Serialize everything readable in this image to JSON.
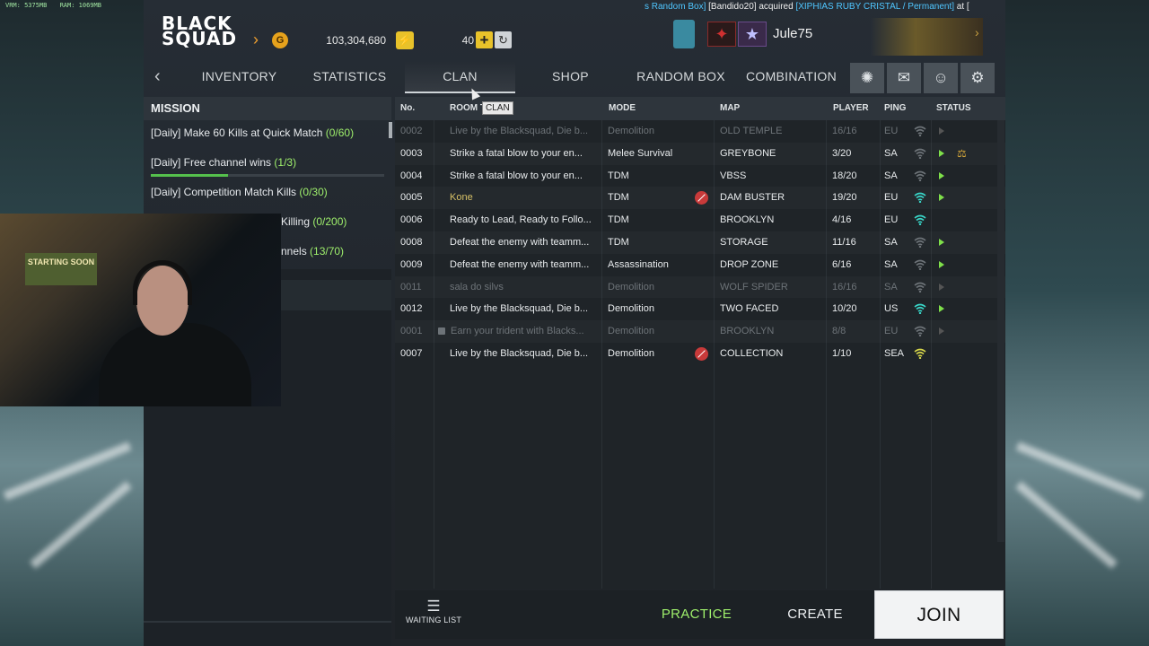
{
  "overlay": {
    "vram": "VRM: 5375MB",
    "ram": "RAM: 1069MB"
  },
  "header": {
    "logo_line1": "BLACK",
    "logo_line2": "SQUAD",
    "gold_icon": "G",
    "gold": "103,304,680",
    "cash": "40",
    "username": "Jule75",
    "ticker_pre": "s Random Box]",
    "ticker_player": "[Bandido20] acquired ",
    "ticker_item": "[XIPHIAS RUBY CRISTAL / Permanent]",
    "ticker_post": " at ["
  },
  "nav": {
    "tabs": [
      "INVENTORY",
      "STATISTICS",
      "CLAN",
      "SHOP",
      "RANDOM BOX",
      "COMBINATION"
    ],
    "active": "CLAN",
    "tooltip": "CLAN",
    "icons": [
      "gear-badge-icon",
      "mail-icon",
      "friends-icon",
      "settings-icon"
    ]
  },
  "mission": {
    "title": "MISSION",
    "items": [
      {
        "label": "[Daily] Make 60 Kills at Quick Match",
        "count": "(0/60)",
        "progress": 0
      },
      {
        "label": "[Daily] Free channel wins",
        "count": "(1/3)",
        "progress": 0.33
      },
      {
        "label": "[Daily] Competition Match Kills",
        "count": "(0/30)",
        "progress": 0
      },
      {
        "label": "Killing",
        "count": "(0/200)",
        "progress": 0
      },
      {
        "label": "nnels",
        "count": "(13/70)",
        "progress": 0
      }
    ]
  },
  "webcam": {
    "poster": "STARTING SOON"
  },
  "table": {
    "headers": {
      "no": "No.",
      "room": "ROOM T",
      "mode": "MODE",
      "map": "MAP",
      "player": "PLAYER",
      "ping": "PING",
      "status": "STATUS"
    },
    "rows": [
      {
        "no": "0002",
        "room": "Live by the Blacksquad, Die b...",
        "mode": "Demolition",
        "map": "OLD TEMPLE",
        "player": "16/16",
        "region": "EU",
        "dim": true,
        "clan": false,
        "restricted": false,
        "locked": false,
        "ping": "weak",
        "play": true,
        "trophy": false
      },
      {
        "no": "0003",
        "room": "Strike a fatal blow to your en...",
        "mode": "Melee Survival",
        "map": "GREYBONE",
        "player": "3/20",
        "region": "SA",
        "dim": false,
        "clan": false,
        "restricted": false,
        "locked": false,
        "ping": "weak",
        "play": true,
        "trophy": true
      },
      {
        "no": "0004",
        "room": "Strike a fatal blow to your en...",
        "mode": "TDM",
        "map": "VBSS",
        "player": "18/20",
        "region": "SA",
        "dim": false,
        "clan": false,
        "restricted": false,
        "locked": false,
        "ping": "weak",
        "play": true,
        "trophy": false
      },
      {
        "no": "0005",
        "room": "Kone",
        "mode": "TDM",
        "map": "DAM BUSTER",
        "player": "19/20",
        "region": "EU",
        "dim": false,
        "clan": true,
        "restricted": true,
        "locked": false,
        "ping": "good",
        "play": true,
        "trophy": false
      },
      {
        "no": "0006",
        "room": "Ready to Lead, Ready to Follo...",
        "mode": "TDM",
        "map": "BROOKLYN",
        "player": "4/16",
        "region": "EU",
        "dim": false,
        "clan": false,
        "restricted": false,
        "locked": false,
        "ping": "good",
        "play": false,
        "trophy": false
      },
      {
        "no": "0008",
        "room": "Defeat the enemy with teamm...",
        "mode": "TDM",
        "map": "STORAGE",
        "player": "11/16",
        "region": "SA",
        "dim": false,
        "clan": false,
        "restricted": false,
        "locked": false,
        "ping": "weak",
        "play": true,
        "trophy": false
      },
      {
        "no": "0009",
        "room": "Defeat the enemy with teamm...",
        "mode": "Assassination",
        "map": "DROP ZONE",
        "player": "6/16",
        "region": "SA",
        "dim": false,
        "clan": false,
        "restricted": false,
        "locked": false,
        "ping": "weak",
        "play": true,
        "trophy": false
      },
      {
        "no": "0011",
        "room": "sala do silvs",
        "mode": "Demolition",
        "map": "WOLF SPIDER",
        "player": "16/16",
        "region": "SA",
        "dim": true,
        "clan": false,
        "restricted": false,
        "locked": false,
        "ping": "weak",
        "play": true,
        "trophy": false
      },
      {
        "no": "0012",
        "room": "Live by the Blacksquad, Die b...",
        "mode": "Demolition",
        "map": "TWO FACED",
        "player": "10/20",
        "region": "US",
        "dim": false,
        "clan": false,
        "restricted": false,
        "locked": false,
        "ping": "good",
        "play": true,
        "trophy": false
      },
      {
        "no": "0001",
        "room": "Earn your trident with Blacks...",
        "mode": "Demolition",
        "map": "BROOKLYN",
        "player": "8/8",
        "region": "EU",
        "dim": true,
        "clan": false,
        "restricted": false,
        "locked": true,
        "ping": "weak",
        "play": true,
        "trophy": false
      },
      {
        "no": "0007",
        "room": "Live by the Blacksquad, Die b...",
        "mode": "Demolition",
        "map": "COLLECTION",
        "player": "1/10",
        "region": "SEA",
        "dim": false,
        "clan": false,
        "restricted": true,
        "locked": false,
        "ping": "medium",
        "play": false,
        "trophy": false
      }
    ]
  },
  "colors": {
    "accent_green": "#9ff06c",
    "ping_good": "#39d6c8",
    "ping_weak": "#6d7378",
    "ping_medium": "#d6d64a",
    "clan_room": "#d6c066"
  },
  "bottom": {
    "waiting_list": "WAITING LIST",
    "practice": "PRACTICE",
    "create": "CREATE",
    "join": "JOIN"
  }
}
